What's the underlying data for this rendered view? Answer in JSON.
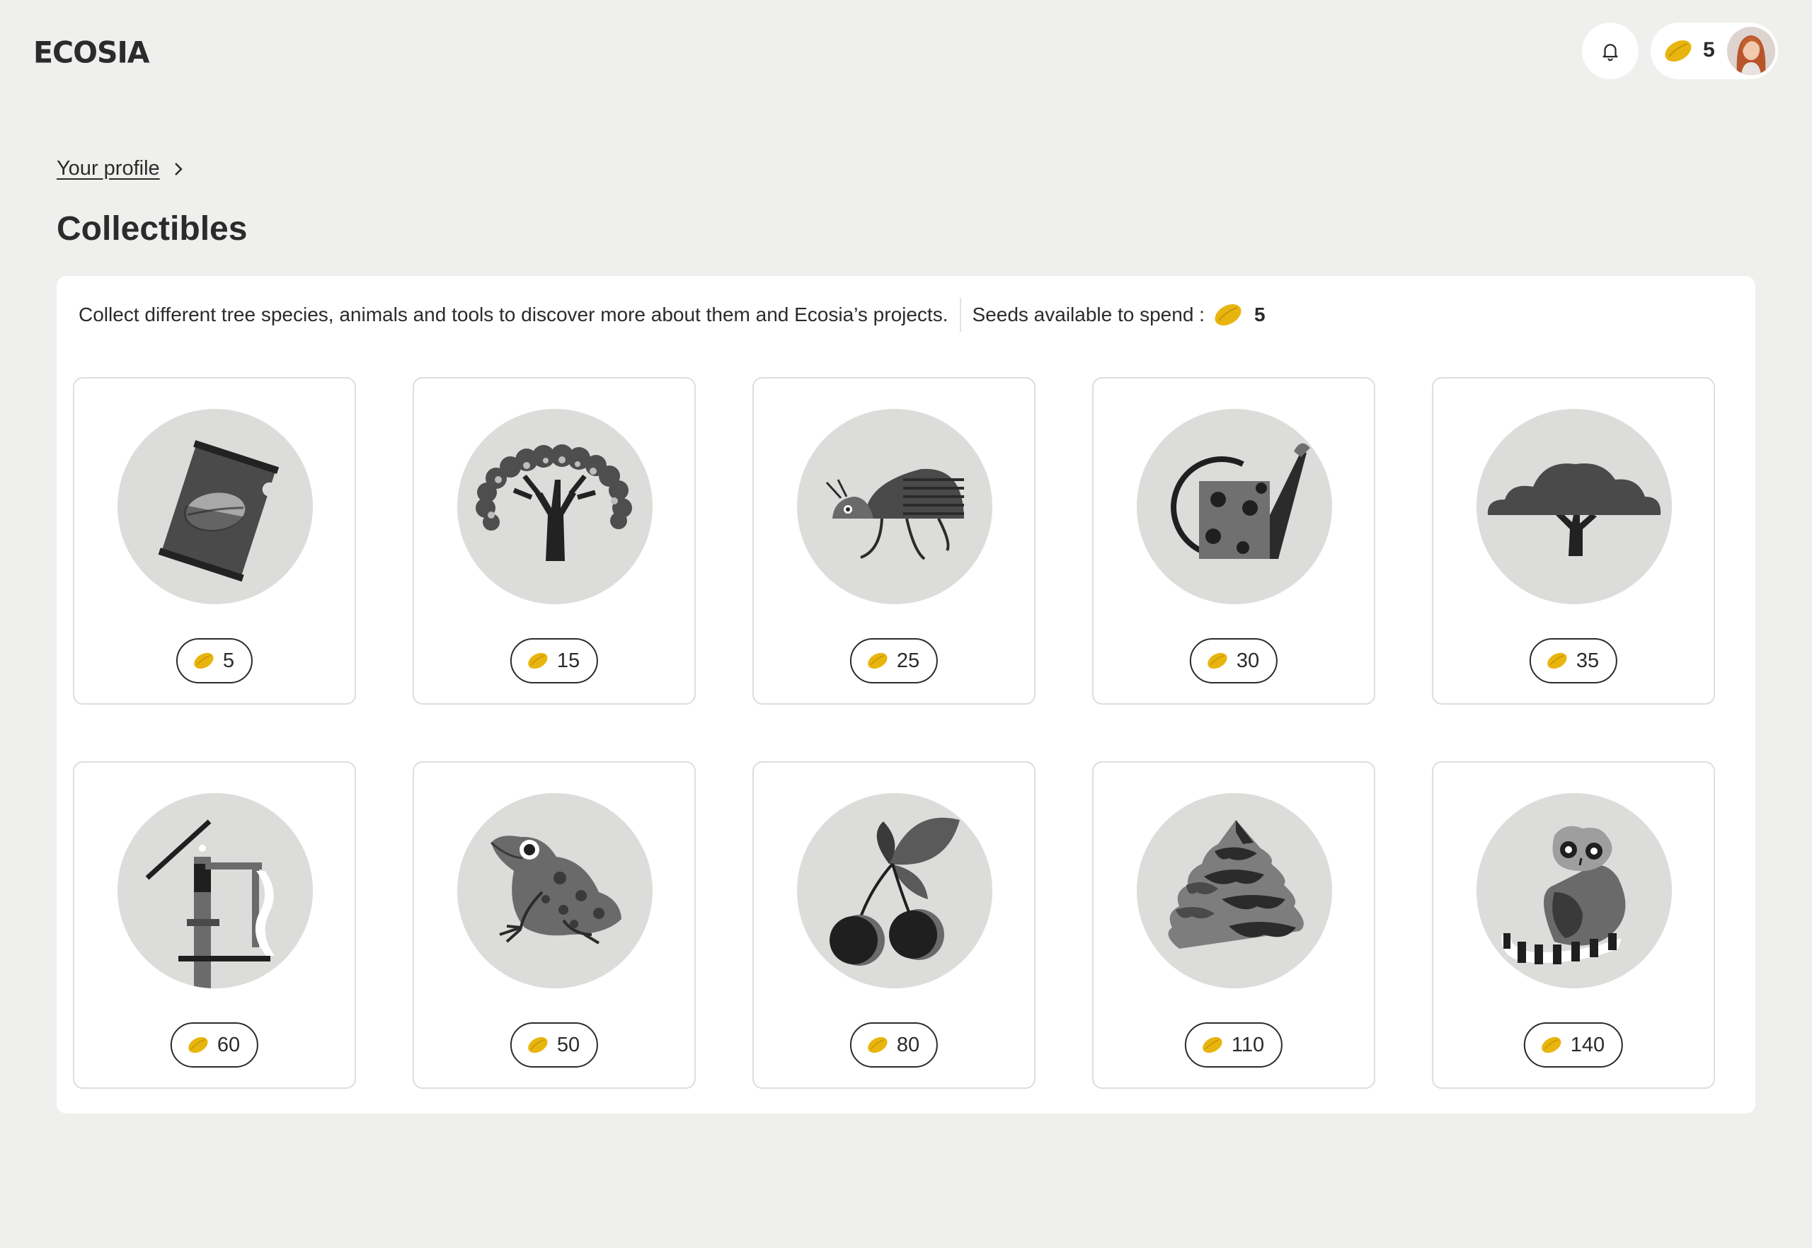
{
  "header": {
    "logo_text": "ECOSIA",
    "notifications_icon": "bell-icon",
    "seed_count": "5",
    "seed_color": "#e8b50e"
  },
  "breadcrumb": {
    "label": "Your profile",
    "icon": "chevron-right-icon"
  },
  "page": {
    "title": "Collectibles"
  },
  "intro": {
    "description": "Collect different tree species, animals and tools to discover more about them and Ecosia’s projects.",
    "seeds_label": "Seeds available to spend :",
    "seeds_available": "5"
  },
  "collectibles": [
    {
      "icon": "seed-packet-icon",
      "price": "5"
    },
    {
      "icon": "baobab-tree-icon",
      "price": "15"
    },
    {
      "icon": "beetle-icon",
      "price": "25"
    },
    {
      "icon": "watering-can-icon",
      "price": "30"
    },
    {
      "icon": "acacia-tree-icon",
      "price": "35"
    },
    {
      "icon": "solar-well-icon",
      "price": "60"
    },
    {
      "icon": "frog-icon",
      "price": "50"
    },
    {
      "icon": "cherries-icon",
      "price": "80"
    },
    {
      "icon": "fir-tree-icon",
      "price": "110"
    },
    {
      "icon": "lemur-icon",
      "price": "140"
    }
  ]
}
